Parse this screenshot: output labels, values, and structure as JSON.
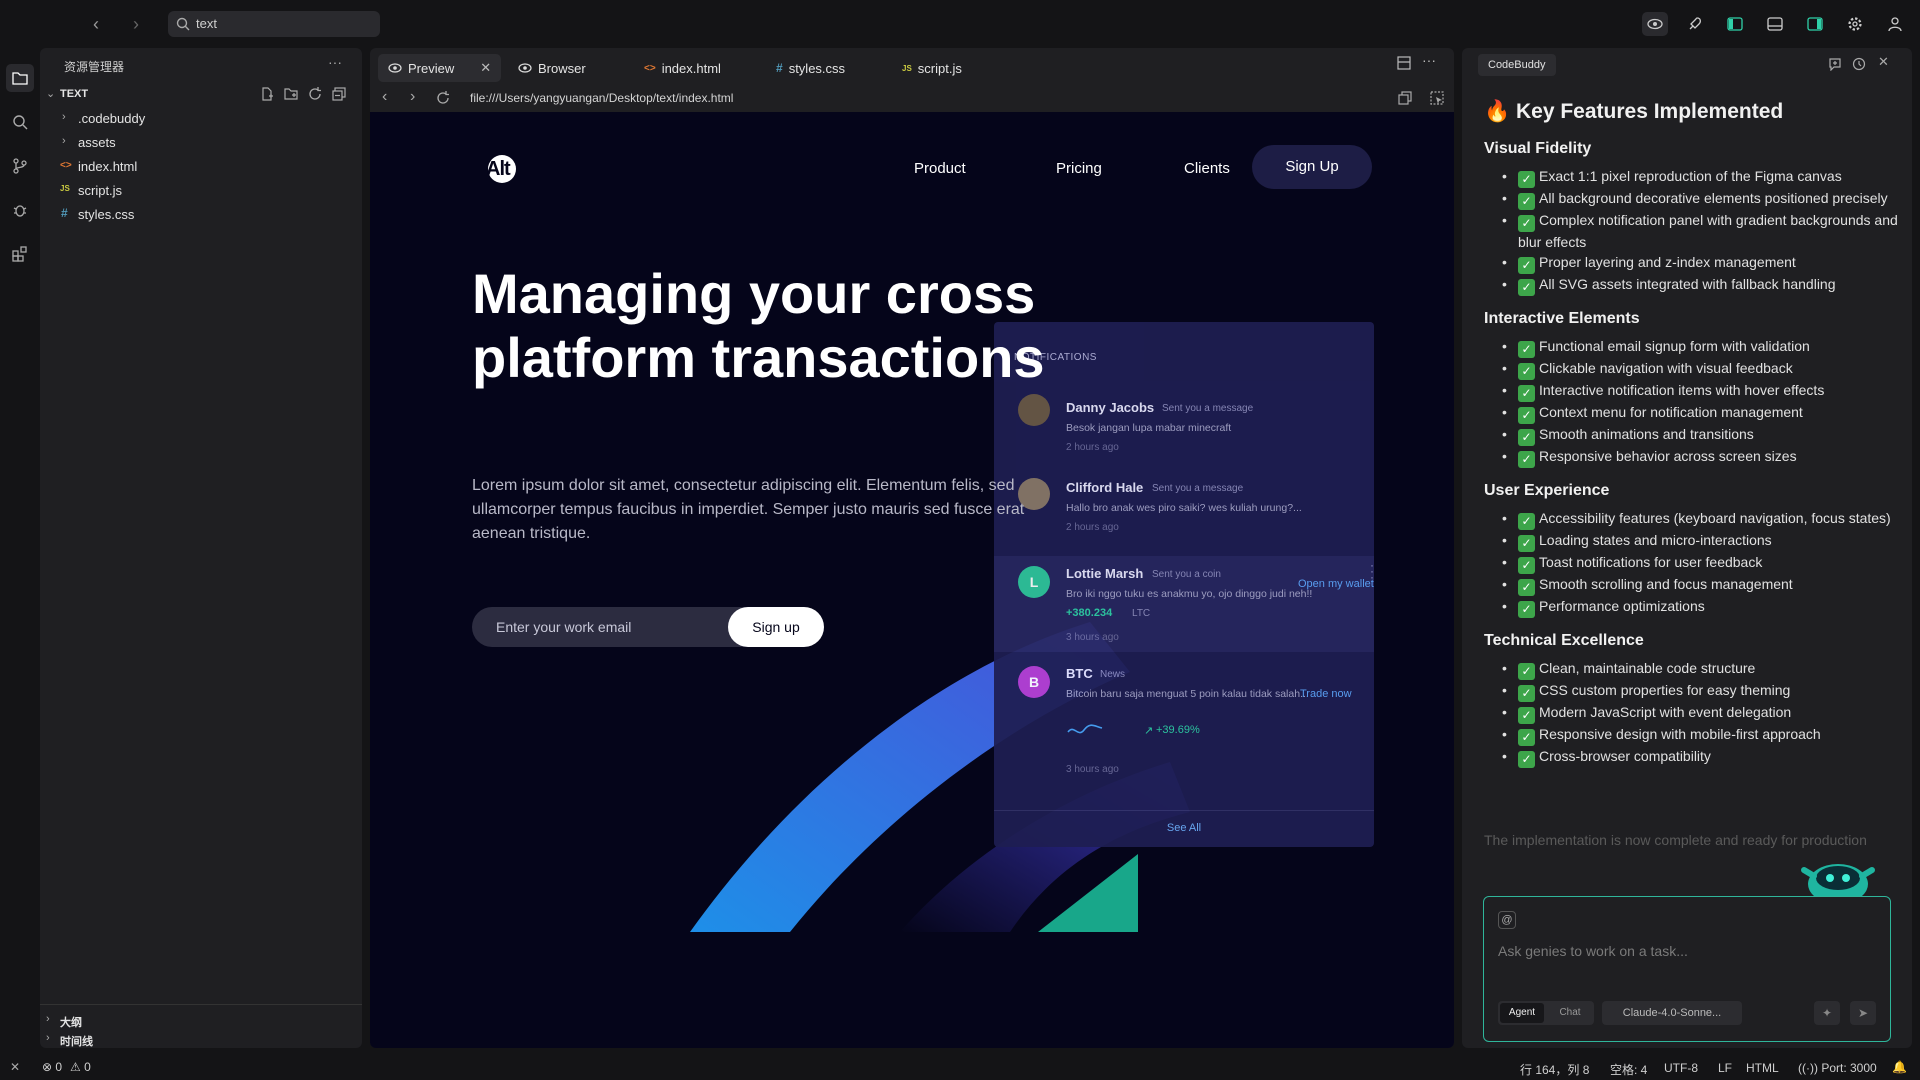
{
  "titlebar": {
    "search_value": "text"
  },
  "explorer": {
    "title": "资源管理器",
    "root": "TEXT",
    "items": [
      {
        "label": ".codebuddy",
        "type": "folder"
      },
      {
        "label": "assets",
        "type": "folder"
      },
      {
        "label": "index.html",
        "type": "html"
      },
      {
        "label": "script.js",
        "type": "js"
      },
      {
        "label": "styles.css",
        "type": "css"
      }
    ],
    "outline": "大纲",
    "timeline": "时间线"
  },
  "tabs": [
    {
      "label": "Preview",
      "icon": "eye-icon"
    },
    {
      "label": "Browser",
      "icon": "eye-icon"
    },
    {
      "label": "index.html",
      "icon": "html-icon"
    },
    {
      "label": "styles.css",
      "icon": "css-icon"
    },
    {
      "label": "script.js",
      "icon": "js-icon"
    }
  ],
  "browser": {
    "url": "file:///Users/yangyuangan/Desktop/text/index.html"
  },
  "site": {
    "logo": "Alt",
    "nav": [
      "Product",
      "Pricing",
      "Clients"
    ],
    "signup_nav": "Sign Up",
    "headline_1": "Managing your cross",
    "headline_2": "platform transactions",
    "paragraph": "Lorem ipsum dolor sit amet, consectetur adipiscing elit. Elementum felis, sed ullamcorper tempus faucibus in imperdiet. Semper justo mauris sed fusce erat aenean tristique.",
    "email_placeholder": "Enter your work email",
    "signup_button": "Sign up",
    "notifications": {
      "title": "NOTIFICATIONS",
      "items": [
        {
          "name": "Danny Jacobs",
          "action": "Sent you a message",
          "message": "Besok jangan lupa mabar minecraft",
          "time": "2 hours ago"
        },
        {
          "name": "Clifford Hale",
          "action": "Sent you a message",
          "message": "Hallo bro anak wes piro saiki? wes kuliah urung?...",
          "time": "2 hours ago"
        },
        {
          "name": "Lottie Marsh",
          "action": "Sent you a coin",
          "initial": "L",
          "message": "Bro iki nggo tuku es anakmu yo, ojo dinggo judi neh!!",
          "amount": "+380.234",
          "currency": "LTC",
          "link": "Open my wallet",
          "time": "3 hours ago"
        },
        {
          "name": "BTC",
          "action": "News",
          "initial": "B",
          "message": "Bitcoin baru saja menguat 5 poin kalau tidak salah...",
          "link": "Trade now",
          "change": "+39.69%",
          "time": "3 hours ago"
        }
      ],
      "see_all": "See All"
    }
  },
  "rpanel": {
    "tab": "CodeBuddy",
    "heading": "🔥 Key Features Implemented",
    "sections": [
      {
        "title": "Visual Fidelity",
        "items": [
          "Exact 1:1 pixel reproduction of the Figma canvas",
          "All background decorative elements positioned precisely",
          "Complex notification panel with gradient backgrounds and blur effects",
          "Proper layering and z-index management",
          "All SVG assets integrated with fallback handling"
        ]
      },
      {
        "title": "Interactive Elements",
        "items": [
          "Functional email signup form with validation",
          "Clickable navigation with visual feedback",
          "Interactive notification items with hover effects",
          "Context menu for notification management",
          "Smooth animations and transitions",
          "Responsive behavior across screen sizes"
        ]
      },
      {
        "title": "User Experience",
        "items": [
          "Accessibility features (keyboard navigation, focus states)",
          "Loading states and micro-interactions",
          "Toast notifications for user feedback",
          "Smooth scrolling and focus management",
          "Performance optimizations"
        ]
      },
      {
        "title": "Technical Excellence",
        "items": [
          "Clean, maintainable code structure",
          "CSS custom properties for easy theming",
          "Modern JavaScript with event delegation",
          "Responsive design with mobile-first approach",
          "Cross-browser compatibility"
        ]
      }
    ],
    "faded_line": "The implementation is now complete and ready for production",
    "chat_placeholder": "Ask genies to work on a task...",
    "mode_agent": "Agent",
    "mode_chat": "Chat",
    "model": "Claude-4.0-Sonne..."
  },
  "status": {
    "errors": "0",
    "warnings": "0",
    "position": "行 164，列 8",
    "spaces": "空格: 4",
    "encoding": "UTF-8",
    "eol": "LF",
    "language": "HTML",
    "port": "Port: 3000"
  }
}
